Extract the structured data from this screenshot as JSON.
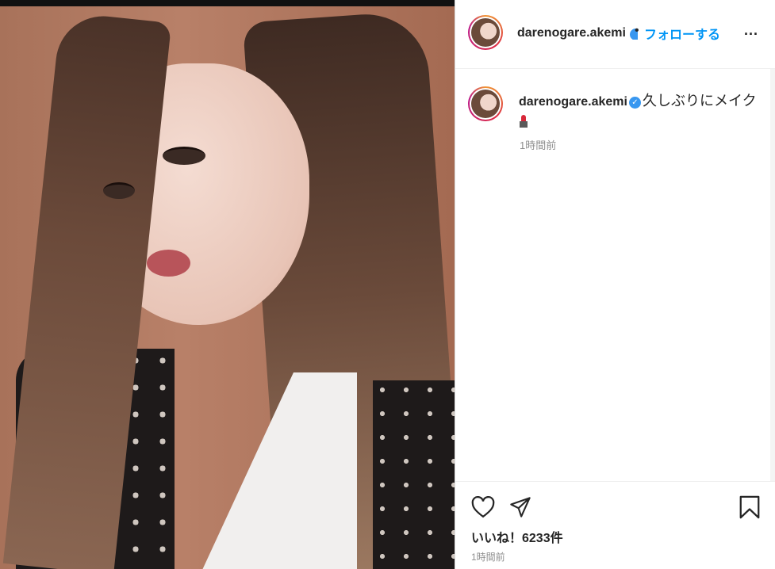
{
  "post": {
    "username": "darenogare.akemi",
    "follow_label": "フォローする",
    "separator": "•",
    "more_label": "...",
    "caption_user": "darenogare.akemi",
    "caption_text": "久しぶりにメイク",
    "caption_time": "1時間前",
    "likes": "いいね！6233件",
    "posted_time": "1時間前"
  },
  "icons": {
    "like": "heart-icon",
    "share": "paper-plane-icon",
    "save": "bookmark-icon",
    "verified": "verified-badge-icon",
    "emoji": "lipstick-icon"
  },
  "colors": {
    "accent": "#0095f6",
    "verified": "#3897f0",
    "muted": "#8e8e8e",
    "text": "#262626"
  }
}
